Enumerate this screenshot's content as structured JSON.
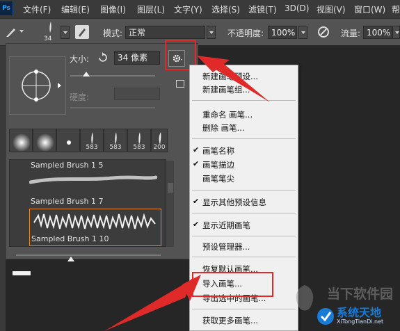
{
  "app": {
    "logo_text": "Ps"
  },
  "menubar": {
    "items": [
      "文件(F)",
      "编辑(E)",
      "图像(I)",
      "图层(L)",
      "文字(Y)",
      "选择(S)",
      "滤镜(T)",
      "3D(D)",
      "视图(V)",
      "窗口(W)",
      "帮"
    ]
  },
  "options_bar": {
    "brush_size": "34",
    "mode_label": "模式:",
    "mode_value": "正常",
    "opacity_label": "不透明度:",
    "opacity_value": "100%",
    "flow_label": "流量:",
    "flow_value": "100%"
  },
  "brush_panel": {
    "size_label": "大小:",
    "size_value": "34 像素",
    "hardness_label": "硬度:",
    "thumb_numbers": [
      "",
      "",
      "",
      "583",
      "583",
      "583",
      "200"
    ],
    "presets": [
      "Sampled Brush 1 5",
      "Sampled Brush 1 7",
      "Sampled Brush 1 10"
    ]
  },
  "context_menu": {
    "items": [
      {
        "label": "新建画笔预设...",
        "checked": false
      },
      {
        "label": "新建画笔组...",
        "checked": false
      },
      {
        "label": "重命名 画笔...",
        "checked": false
      },
      {
        "label": "删除 画笔...",
        "checked": false
      },
      {
        "label": "画笔名称",
        "checked": true
      },
      {
        "label": "画笔描边",
        "checked": true
      },
      {
        "label": "画笔笔尖",
        "checked": false
      },
      {
        "label": "显示其他预设信息",
        "checked": true
      },
      {
        "label": "显示近期画笔",
        "checked": true
      },
      {
        "label": "预设管理器...",
        "checked": false
      },
      {
        "label": "恢复默认画笔...",
        "checked": false
      },
      {
        "label": "导入画笔...",
        "checked": false
      },
      {
        "label": "导出选中的画笔...",
        "checked": false
      },
      {
        "label": "获取更多画笔...",
        "checked": false
      }
    ]
  },
  "watermark": {
    "text": "当下软件园",
    "brand": "系统天地",
    "url": "XiTongTianDi.net"
  },
  "colors": {
    "highlight": "#e02929",
    "panel": "#535353",
    "menubar": "#3a3a3a"
  }
}
